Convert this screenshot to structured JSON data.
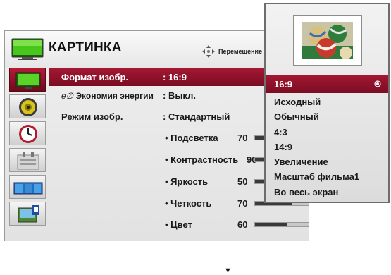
{
  "header": {
    "title": "КАРТИНКА",
    "move_label": "Перемещение",
    "icon": "tv-icon"
  },
  "sidebar": {
    "items": [
      {
        "icon": "picture-icon",
        "selected": true
      },
      {
        "icon": "speaker-icon"
      },
      {
        "icon": "clock-icon"
      },
      {
        "icon": "settings-icon"
      },
      {
        "icon": "screen-icon"
      },
      {
        "icon": "photo-icon"
      }
    ]
  },
  "settings": {
    "format": {
      "label": "Формат изобр.",
      "value": ": 16:9"
    },
    "energy": {
      "label": "Экономия энергии",
      "value": ": Выкл."
    },
    "mode": {
      "label": "Режим изобр.",
      "value": ": Стандартный"
    },
    "backlight": {
      "label": "• Подсветка",
      "value": "70"
    },
    "contrast": {
      "label": "• Контрастность",
      "value": "90"
    },
    "brightness": {
      "label": "• Яркость",
      "value": "50"
    },
    "sharpness": {
      "label": "• Четкость",
      "value": "70"
    },
    "color": {
      "label": "• Цвет",
      "value": "60"
    }
  },
  "popup": {
    "options": [
      "16:9",
      "Исходный",
      "Обычный",
      "4:3",
      "14:9",
      "Увеличение",
      "Масштаб фильма1",
      "Во весь экран"
    ],
    "selected": "16:9"
  },
  "colors": {
    "accent": "#8f1029",
    "bar_fill": "#3a3a3a",
    "bar_track": "#c8c8c8"
  }
}
